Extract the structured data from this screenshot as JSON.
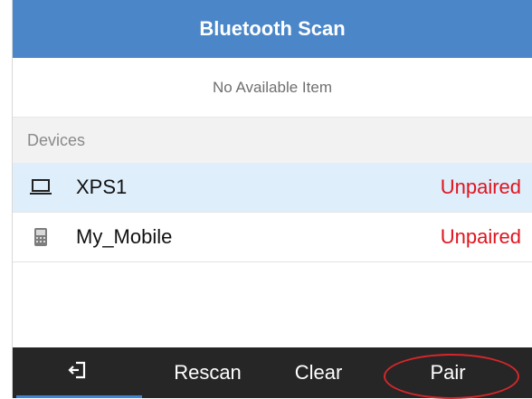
{
  "title": "Bluetooth Scan",
  "status_message": "No Available Item",
  "section_header": "Devices",
  "devices": [
    {
      "name": "XPS1",
      "status": "Unpaired",
      "icon": "laptop-icon",
      "selected": true
    },
    {
      "name": "My_Mobile",
      "status": "Unpaired",
      "icon": "mobile-phone-icon",
      "selected": false
    }
  ],
  "bottom_bar": {
    "back_icon": "exit-icon",
    "rescan_label": "Rescan",
    "clear_label": "Clear",
    "pair_label": "Pair"
  },
  "colors": {
    "title_bar": "#4a86c8",
    "selected_row": "#deeefb",
    "status_unpaired": "#e0141e",
    "bottom_bar": "#262626",
    "highlight": "#d6262b"
  }
}
